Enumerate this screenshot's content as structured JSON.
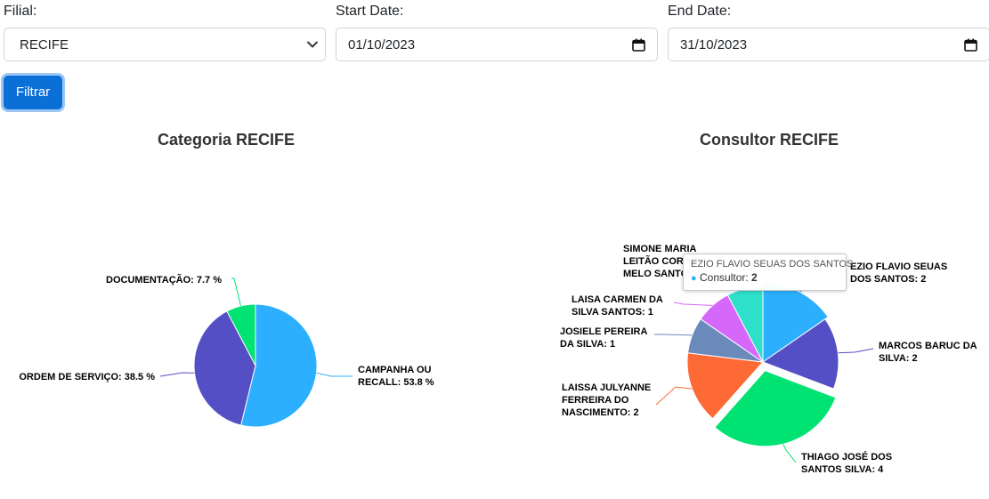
{
  "filters": {
    "filial": {
      "label": "Filial:",
      "value": "RECIFE"
    },
    "start": {
      "label": "Start Date:",
      "value": "01/10/2023"
    },
    "end": {
      "label": "End Date:",
      "value": "31/10/2023"
    },
    "button_label": "Filtrar"
  },
  "chart_data": [
    {
      "type": "pie",
      "title": "Categoria RECIFE",
      "slices": [
        {
          "name": "CAMPANHA OU RECALL",
          "value": 53.8,
          "label_lines": [
            "CAMPANHA OU",
            "RECALL: 53.8 %"
          ],
          "color": "#2caffe"
        },
        {
          "name": "ORDEM DE SERVIÇO",
          "value": 38.5,
          "label_lines": [
            "ORDEM DE SERVIÇO: 38.5 %"
          ],
          "color": "#544fc5"
        },
        {
          "name": "DOCUMENTAÇÃO",
          "value": 7.7,
          "label_lines": [
            "DOCUMENTAÇÃO: 7.7 %"
          ],
          "color": "#00e272"
        }
      ]
    },
    {
      "type": "pie",
      "title": "Consultor RECIFE",
      "series_name": "Consultor",
      "slices": [
        {
          "name": "EZIO FLAVIO SEUAS DOS SANTOS",
          "value": 2,
          "label_lines": [
            "EZIO FLAVIO SEUAS",
            "DOS SANTOS: 2"
          ],
          "color": "#2caffe"
        },
        {
          "name": "MARCOS BARUC DA SILVA",
          "value": 2,
          "label_lines": [
            "MARCOS BARUC DA",
            "SILVA: 2"
          ],
          "color": "#544fc5"
        },
        {
          "name": "THIAGO JOSÉ DOS SANTOS SILVA",
          "value": 4,
          "label_lines": [
            "THIAGO JOSÉ DOS",
            "SANTOS SILVA: 4"
          ],
          "color": "#00e272"
        },
        {
          "name": "LAISSA JULYANNE FERREIRA DO NASCIMENTO",
          "value": 2,
          "label_lines": [
            "LAISSA JULYANNE",
            "FERREIRA DO",
            "NASCIMENTO: 2"
          ],
          "color": "#fe6a35"
        },
        {
          "name": "JOSIELE PEREIRA DA SILVA",
          "value": 1,
          "label_lines": [
            "JOSIELE PEREIRA",
            "DA SILVA: 1"
          ],
          "color": "#6b8abc"
        },
        {
          "name": "LAISA CARMEN DA SILVA SANTOS",
          "value": 1,
          "label_lines": [
            "LAISA CARMEN DA",
            "SILVA SANTOS: 1"
          ],
          "color": "#d568fb"
        },
        {
          "name": "SIMONE MARIA LEITÃO CORREIA MELO SANTOS",
          "value": 1,
          "label_lines": [
            "SIMONE MARIA",
            "LEITÃO CORREIA",
            "MELO SANTOS: 1"
          ],
          "color": "#2ee0ca"
        }
      ],
      "tooltip": {
        "title": "EZIO FLAVIO SEUAS DOS SANTOS",
        "series": "Consultor",
        "value": "2"
      }
    }
  ]
}
